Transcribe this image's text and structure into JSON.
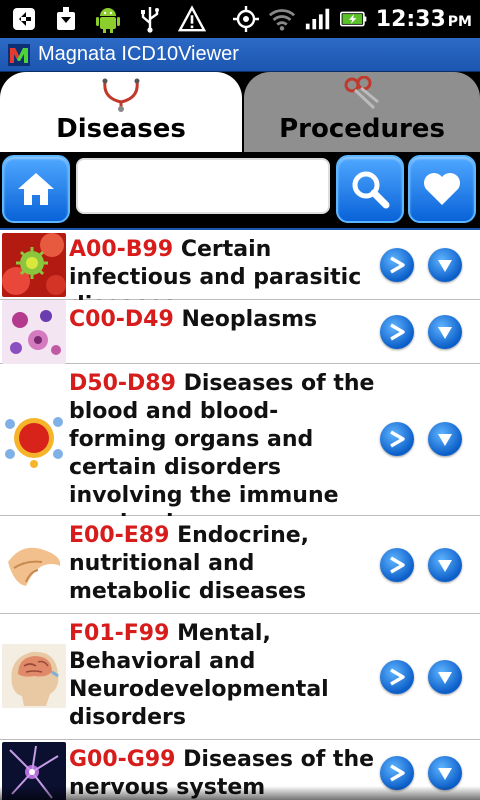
{
  "status_bar": {
    "time": "12:33",
    "ampm": "PM",
    "icons": [
      "back-arrow-icon",
      "download-icon",
      "android-icon",
      "usb-icon",
      "warning-icon",
      "gps-icon",
      "wifi-icon",
      "signal-icon",
      "battery-charging-icon"
    ]
  },
  "app": {
    "title": "Magnata ICD10Viewer"
  },
  "tabs": [
    {
      "label": "Diseases",
      "icon": "stethoscope-icon",
      "selected": true
    },
    {
      "label": "Procedures",
      "icon": "scissors-icon",
      "selected": false
    }
  ],
  "toolbar": {
    "home_icon": "home-icon",
    "search_value": "",
    "search_icon": "search-icon",
    "favorites_icon": "heart-icon"
  },
  "rows": [
    {
      "code": "A00-B99",
      "title": "Certain infectious and parasitic diseases",
      "thumb": "virus-image"
    },
    {
      "code": "C00-D49",
      "title": "Neoplasms",
      "thumb": "cells-image"
    },
    {
      "code": "D50-D89",
      "title": "Diseases of the blood and blood-forming organs and certain disorders involving the immune mechanism",
      "thumb": "blood-cell-image"
    },
    {
      "code": "E00-E89",
      "title": "Endocrine, nutritional and metabolic diseases",
      "thumb": "pancreas-image"
    },
    {
      "code": "F01-F99",
      "title": "Mental, Behavioral and Neurodevelopmental disorders",
      "thumb": "brain-image"
    },
    {
      "code": "G00-G99",
      "title": "Diseases of the nervous system",
      "thumb": "neuron-image"
    }
  ]
}
